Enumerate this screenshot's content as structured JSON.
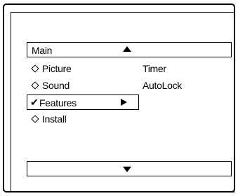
{
  "menu": {
    "title": "Main",
    "scroll_up_icon": "triangle-up-icon",
    "scroll_down_icon": "triangle-down-icon",
    "left_items": [
      {
        "label": "Picture",
        "icon": "diamond-icon"
      },
      {
        "label": "Sound",
        "icon": "diamond-icon"
      },
      {
        "label": "Features",
        "icon": "checkmark-icon",
        "selected": true,
        "submenu_icon": "triangle-right-icon"
      },
      {
        "label": "Install",
        "icon": "diamond-icon"
      }
    ],
    "right_items": [
      {
        "label": "Timer"
      },
      {
        "label": "AutoLock"
      }
    ],
    "check_glyph": "✔"
  }
}
